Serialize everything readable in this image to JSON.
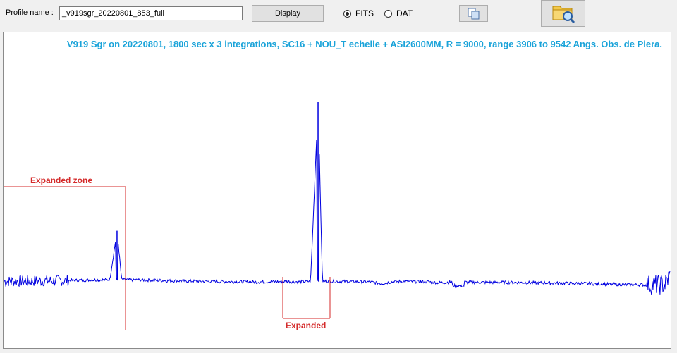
{
  "toolbar": {
    "profile_label": "Profile name :",
    "profile_value": "_v919sgr_20220801_853_full",
    "display_label": "Display",
    "radio_fits": "FITS",
    "radio_dat": "DAT",
    "selected_format": "FITS",
    "copy_icon": "copy-icon",
    "folder_icon": "folder-search-icon"
  },
  "plot": {
    "title": "V919 Sgr on 20220801, 1800 sec x 3 integrations, SC16 + NOU_T echelle + ASI2600MM, R = 9000, range 3906 to 9542 Angs. Obs. de Piera.",
    "annotations": {
      "zone_label": "Expanded zone",
      "expanded_label": "Expanded"
    },
    "colors": {
      "spectrum": "#0000e0",
      "title": "#1aa3d9",
      "annotation": "#d42a2a"
    }
  },
  "chart_data": {
    "type": "line",
    "title": "V919 Sgr on 20220801, 1800 sec x 3 integrations, SC16 + NOU_T echelle + ASI2600MM, R = 9000, range 3906 to 9542 Angs. Obs. de Piera.",
    "xlabel": "",
    "ylabel": "",
    "xlim": [
      3906,
      9542
    ],
    "series": [
      {
        "values_note": "",
        "x": [
          3906,
          4000,
          4100,
          4200,
          4300,
          4400,
          4500,
          4600,
          4700,
          4800,
          4861,
          4900,
          5000,
          5100,
          5200,
          5300,
          5400,
          5500,
          5600,
          5700,
          5800,
          5900,
          6000,
          6100,
          6200,
          6300,
          6400,
          6500,
          6563,
          6600,
          6700,
          6800,
          6900,
          7000,
          7100,
          7200,
          7300,
          7400,
          7500,
          7600,
          7700,
          7800,
          7900,
          8000,
          8100,
          8200,
          8300,
          8400,
          8500,
          8600,
          8700,
          8800,
          8900,
          9000,
          9100,
          9200,
          9300,
          9400,
          9500,
          9542
        ],
        "y": [
          0.95,
          0.95,
          0.96,
          0.97,
          0.98,
          1.0,
          1.0,
          1.02,
          1.03,
          1.05,
          4.2,
          1.05,
          1.03,
          1.02,
          1.0,
          0.98,
          0.97,
          0.95,
          0.94,
          0.93,
          0.92,
          0.91,
          0.9,
          0.91,
          0.92,
          0.93,
          0.92,
          0.94,
          12.5,
          0.95,
          0.94,
          0.93,
          0.92,
          0.9,
          0.8,
          0.92,
          0.93,
          0.92,
          0.91,
          0.85,
          0.9,
          0.89,
          0.88,
          0.87,
          0.88,
          0.87,
          0.86,
          0.85,
          0.84,
          0.82,
          0.81,
          0.8,
          0.78,
          0.76,
          0.74,
          0.72,
          0.72,
          0.7,
          0.75,
          1.3
        ]
      }
    ]
  }
}
